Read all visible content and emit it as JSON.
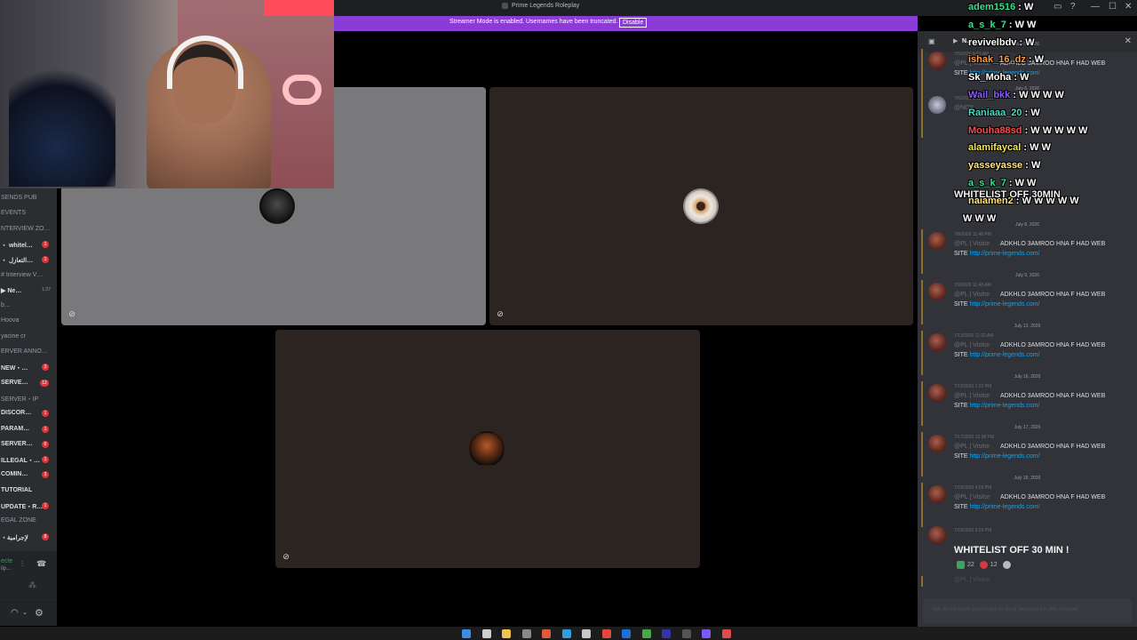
{
  "window": {
    "title": "Prime Legends Roleplay",
    "controls": [
      "—",
      "☐",
      "✕"
    ]
  },
  "banner": {
    "text": "Streamer Mode is enabled. Usernames have been truncated.",
    "disable_label": "Disable"
  },
  "channels": [
    {
      "label": "SENDS PUB",
      "kind": "cat"
    },
    {
      "label": "EVENTS",
      "kind": "cat"
    },
    {
      "label": "NTERVIEW ZO…",
      "kind": "cat"
    },
    {
      "label": "・ whitel…",
      "kind": "chan",
      "badge": "1"
    },
    {
      "label": "・ التعازل…",
      "kind": "chan",
      "badge": "1"
    },
    {
      "label": "# Interview V…",
      "kind": "dim"
    },
    {
      "label": "▶ Ne…",
      "kind": "chan",
      "extra": "1:27"
    },
    {
      "label": "b…",
      "kind": "dim"
    },
    {
      "label": "Hoova",
      "kind": "dim"
    },
    {
      "label": "yacine cr",
      "kind": "dim"
    },
    {
      "label": "ERVER ANNO…",
      "kind": "cat"
    },
    {
      "label": "NEW・…",
      "kind": "chan",
      "badge": "3"
    },
    {
      "label": "SERVE…",
      "kind": "chan",
      "badge": "12"
    },
    {
      "label": "SERVER・IP",
      "kind": "cat"
    },
    {
      "label": "DISCOR…",
      "kind": "chan",
      "badge": "1"
    },
    {
      "label": "PARAM…",
      "kind": "chan",
      "badge": "1"
    },
    {
      "label": "SERVER…",
      "kind": "chan",
      "badge": "6"
    },
    {
      "label": "ILLEGAL・…",
      "kind": "chan",
      "badge": "1"
    },
    {
      "label": "COMIN…",
      "kind": "chan",
      "badge": "3"
    },
    {
      "label": "TUTORIAL",
      "kind": "chan"
    },
    {
      "label": "UPDATE・R…",
      "kind": "chan",
      "badge": "1"
    },
    {
      "label": "EGAL ZONE",
      "kind": "cat"
    },
    {
      "label": "・لإجرامية",
      "kind": "chan",
      "badge": "8"
    }
  ],
  "user_panel": {
    "status_line1": "ecte",
    "status_line2": "ilp…"
  },
  "chat": {
    "channel_name": "N…",
    "placeholder": "You do not have permission to send messages in this channel.",
    "messages": [
      {
        "date": "July 5, 2026",
        "meta": "7/5/2026 9:52 AM",
        "role": "@PL | Visitor",
        "text": "ADKHLO 3AMROO HNA F HAD WEB",
        "site": "SITE",
        "url": "http://prime-legends.com/"
      },
      {
        "date": "July 6, 2026",
        "meta": "7/6/2026 3:12 PM",
        "role": "@NOX",
        "text": "",
        "site": "",
        "url": ""
      },
      {
        "date": "July 8, 2026",
        "meta": "7/8/2026 11:48 PM",
        "role": "@PL | Visitor",
        "text": "ADKHLO 3AMROO HNA F HAD WEB",
        "site": "SITE",
        "url": "http://prime-legends.com/"
      },
      {
        "date": "July 9, 2026",
        "meta": "7/9/2026 11:48 AM",
        "role": "@PL | Visitor",
        "text": "ADKHLO 3AMROO HNA F HAD WEB",
        "site": "SITE",
        "url": "http://prime-legends.com/"
      },
      {
        "date": "July 13, 2026",
        "meta": "7/13/2026 11:32 AM",
        "role": "@PL | Visitor",
        "text": "ADKHLO 3AMROO HNA F HAD WEB",
        "site": "SITE",
        "url": "http://prime-legends.com/"
      },
      {
        "date": "July 16, 2026",
        "meta": "7/15/2026 1:22 PM",
        "role": "@PL | Visitor",
        "text": "ADKHLO 3AMROO HNA F HAD WEB",
        "site": "SITE",
        "url": "http://prime-legends.com/"
      },
      {
        "date": "July 17, 2026",
        "meta": "7/17/2026 12:38 PM",
        "role": "@PL | Visitor",
        "text": "ADKHLO 3AMROO HNA F HAD WEB",
        "site": "SITE",
        "url": "http://prime-legends.com/"
      },
      {
        "date": "July 18, 2026",
        "meta": "7/18/2026 4:09 PM",
        "role": "@PL | Visitor",
        "text": "ADKHLO 3AMROO HNA F HAD WEB",
        "site": "SITE",
        "url": "http://prime-legends.com/"
      }
    ],
    "final_message": {
      "meta": "7/18/2026 9:29 PM",
      "text": "WHITELIST OFF 30 MIN !",
      "reactions": [
        {
          "icon": "check-emoji",
          "count": "22",
          "color": "#3ba55d"
        },
        {
          "icon": "heart-emoji",
          "count": "12",
          "color": "#da373c"
        }
      ]
    },
    "trailing_reply": "@PL | Visitor"
  },
  "twitch_chat": [
    {
      "user": "adem1516",
      "color": "#3be08f",
      "msg": "W"
    },
    {
      "user": "a_s_k_7",
      "color": "#3be08f",
      "msg": "W W"
    },
    {
      "user": "revivelbdv",
      "color": "#ffffff",
      "msg": "W"
    },
    {
      "user": "ishak_16_dz",
      "color": "#ff9a3c",
      "msg": "W"
    },
    {
      "user": "Sk_Moha",
      "color": "#ffffff",
      "msg": "W"
    },
    {
      "user": "Wail_bkk",
      "color": "#8a5cff",
      "msg": "W W W W"
    },
    {
      "user": "Raniaaa_20",
      "color": "#3be0c8",
      "msg": "W"
    },
    {
      "user": "Mouha88sd",
      "color": "#ff4b4b",
      "msg": "W W W W W"
    },
    {
      "user": "alamifaycal",
      "color": "#f2e94e",
      "msg": "W W"
    },
    {
      "user": "yasseyasse",
      "color": "#ffe680",
      "msg": "W"
    },
    {
      "user": "a_s_k_7",
      "color": "#3be08f",
      "msg": "W W"
    },
    {
      "user": "nalamen2",
      "color": "#ffe680",
      "msg": "W W W W W"
    },
    {
      "user": "",
      "color": "#ffffff",
      "msg": "W W W"
    }
  ],
  "twitch_overlay_text": "WHITELIST OFF 30MIN"
}
